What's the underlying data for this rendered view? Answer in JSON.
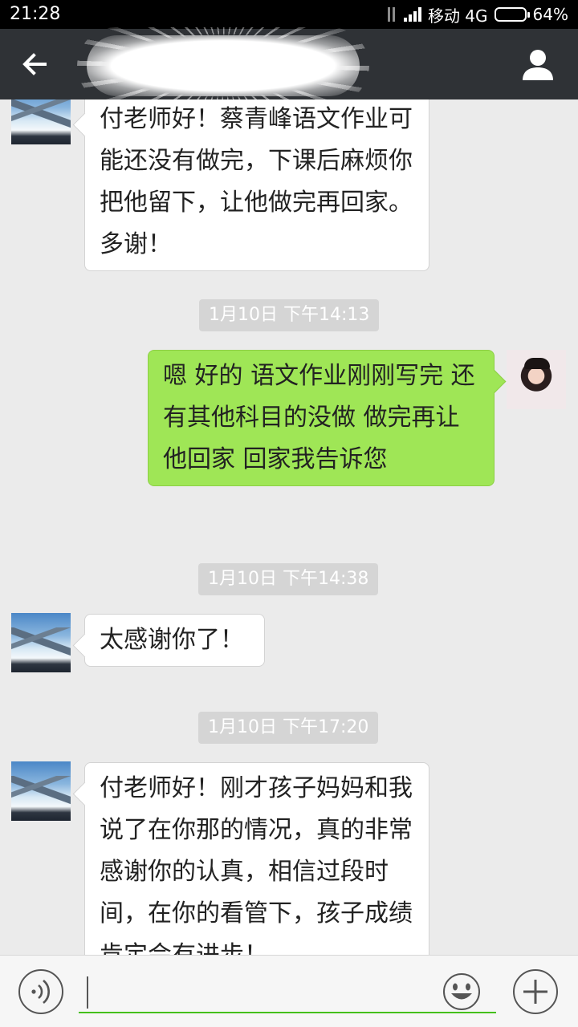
{
  "status_bar": {
    "time": "21:28",
    "carrier": "移动 4G",
    "battery": "64%",
    "battery_level": 0.64
  },
  "header": {
    "back_icon": "arrow-left-icon",
    "title_obscured": true,
    "profile_icon": "person-icon"
  },
  "messages": [
    {
      "side": "left",
      "avatar": "mountain-avatar",
      "text": "付老师好！蔡青峰语文作业可能还没有做完，下课后麻烦你把他留下，让他做完再回家。多谢！"
    },
    {
      "timestamp": "1月10日 下午14:13"
    },
    {
      "side": "right",
      "avatar": "girl-avatar",
      "text": "嗯  好的  语文作业刚刚写完  还有其他科目的没做  做完再让他回家 回家我告诉您"
    },
    {
      "timestamp": "1月10日 下午14:38"
    },
    {
      "side": "left",
      "avatar": "mountain-avatar",
      "text": "太感谢你了！"
    },
    {
      "timestamp": "1月10日 下午17:20"
    },
    {
      "side": "left",
      "avatar": "mountain-avatar",
      "text": "付老师好！刚才孩子妈妈和我说了在你那的情况，真的非常感谢你的认真，相信过段时间，在你的看管下，孩子成绩肯定会有进步！"
    }
  ],
  "input_bar": {
    "voice_icon": "voice-icon",
    "text_value": "",
    "emoji_icon": "smiley-icon",
    "plus_icon": "plus-icon"
  },
  "colors": {
    "header_bg": "#2f3236",
    "chat_bg": "#ebebeb",
    "right_bubble": "#9fe656",
    "left_bubble": "#ffffff",
    "input_underline": "#45c01a"
  }
}
